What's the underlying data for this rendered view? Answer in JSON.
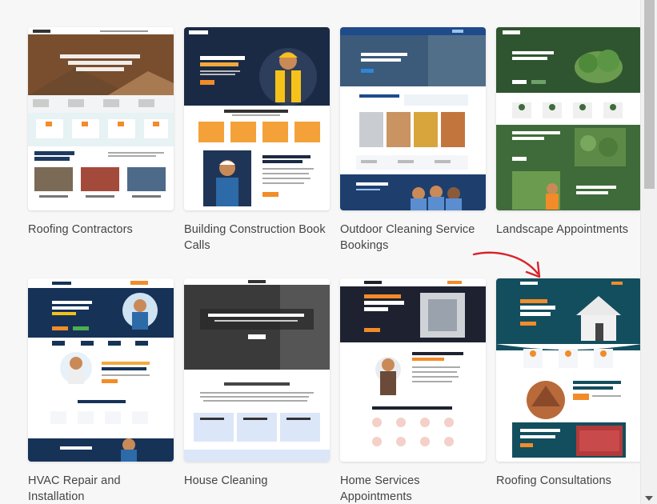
{
  "templates": [
    {
      "title": "Roofing Contractors"
    },
    {
      "title": "Building Construction Book Calls"
    },
    {
      "title": "Outdoor Cleaning Service Bookings"
    },
    {
      "title": "Landscape Appointments"
    },
    {
      "title": "HVAC Repair and Installation"
    },
    {
      "title": "House Cleaning"
    },
    {
      "title": "Home Services Appointments"
    },
    {
      "title": "Roofing Consultations"
    }
  ],
  "colors": {
    "annotation_arrow": "#d9232a",
    "roofing_accent": "#f28c28",
    "construction_navy": "#1b2a44",
    "cleaning_blue": "#1f4b8a",
    "landscape_green": "#3f6b3a",
    "hvac_navy": "#163257",
    "cleaning_dark": "#222222",
    "home_services_dark": "#1e2230",
    "roofing_consult_teal": "#134e5e"
  },
  "icons": [
    "scroll-down-arrow-icon",
    "annotation-arrow-icon"
  ]
}
